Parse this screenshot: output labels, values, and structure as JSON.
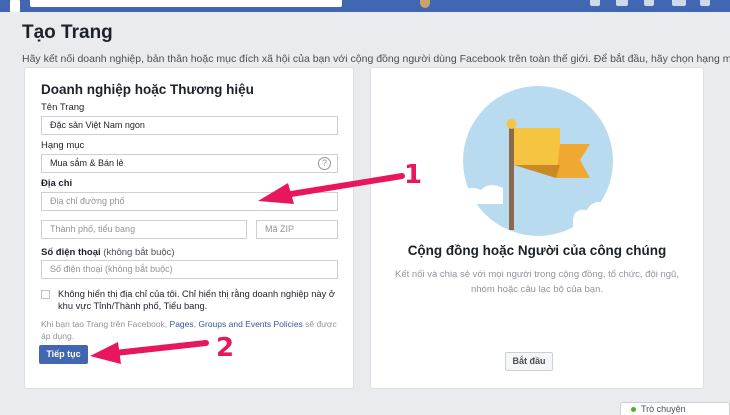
{
  "page": {
    "title": "Tạo Trang",
    "description": "Hãy kết nối doanh nghiệp, bản thân hoặc mục đích xã hội của bạn với cộng đồng người dùng Facebook trên toàn thế giới. Để bắt đầu, hãy chọn hạng mục"
  },
  "business_card": {
    "title": "Doanh nghiệp hoặc Thương hiệu",
    "page_name_label": "Tên Trang",
    "page_name_value": "Đặc sản Việt Nam ngon",
    "category_label": "Hạng mục",
    "category_value": "Mua sắm & Bán lẻ",
    "address_label": "Địa chỉ",
    "street_placeholder": "Địa chỉ đường phố",
    "city_placeholder": "Thành phố, tiểu bang",
    "zip_placeholder": "Mã ZIP",
    "phone_label": "Số điện thoại",
    "phone_optional": "(không bắt buộc)",
    "phone_placeholder": "Số điện thoại (không bắt buộc)",
    "hide_address_text": "Không hiển thị địa chỉ của tôi. Chỉ hiển thị rằng doanh nghiệp này ở khu vực Tỉnh/Thành phố, Tiểu bang.",
    "hide_address_checked": false,
    "policy_prefix": "Khi bạn tạo Trang trên Facebook, ",
    "policy_link_pages": "Pages",
    "policy_sep": ", ",
    "policy_link_groups": "Groups and Events Policies",
    "policy_suffix": " sẽ được áp dụng.",
    "continue_label": "Tiếp tục"
  },
  "community_card": {
    "title": "Cộng đồng hoặc Người của công chúng",
    "description": "Kết nối và chia sẻ với mọi người trong cộng đồng, tổ chức, đội ngũ, nhóm hoặc câu lạc bộ của bạn.",
    "start_label": "Bắt đầu",
    "illustration_icon": "flag-icon"
  },
  "chat": {
    "label": "Trò chuyện",
    "status_color": "#42b72a"
  },
  "annotations": {
    "arrow_1_number": "1",
    "arrow_2_number": "2",
    "color": "#e8175d"
  },
  "colors": {
    "brand": "#4267b2",
    "background": "#e9ebee",
    "link": "#365899"
  }
}
